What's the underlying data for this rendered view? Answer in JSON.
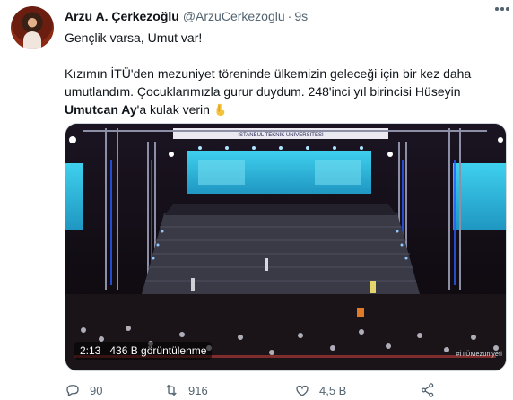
{
  "tweet": {
    "author_name": "Arzu A. Çerkezoğlu",
    "handle": "@ArzuCerkezoglu",
    "separator": "·",
    "time": "9s",
    "line1": "Gençlik varsa, Umut var!",
    "line2_before_mention": "Kızımın İTÜ'den mezuniyet töreninde ülkemizin geleceği için bir kez daha umutlandım. Çocuklarımızla gurur duydum. 248'inci yıl birincisi Hüseyin ",
    "mention": "Umutcan Ay",
    "line2_after_mention": "'a kulak verin",
    "emoji_icon": "backhand-index-pointing-down-icon"
  },
  "media": {
    "duration": "2:13",
    "views": "436 B görüntülenme",
    "venue_banner": "İSTANBUL TEKNİK ÜNİVERSİTESİ",
    "hashtag": "#İTÜMezuniyeti"
  },
  "actions": {
    "reply_count": "90",
    "retweet_count": "916",
    "like_count": "4,5 B",
    "icons": [
      "reply-icon",
      "retweet-icon",
      "like-icon",
      "share-icon"
    ]
  },
  "colors": {
    "text_primary": "#0f1419",
    "text_secondary": "#536471",
    "stage_screen": "#2ab6d8"
  }
}
